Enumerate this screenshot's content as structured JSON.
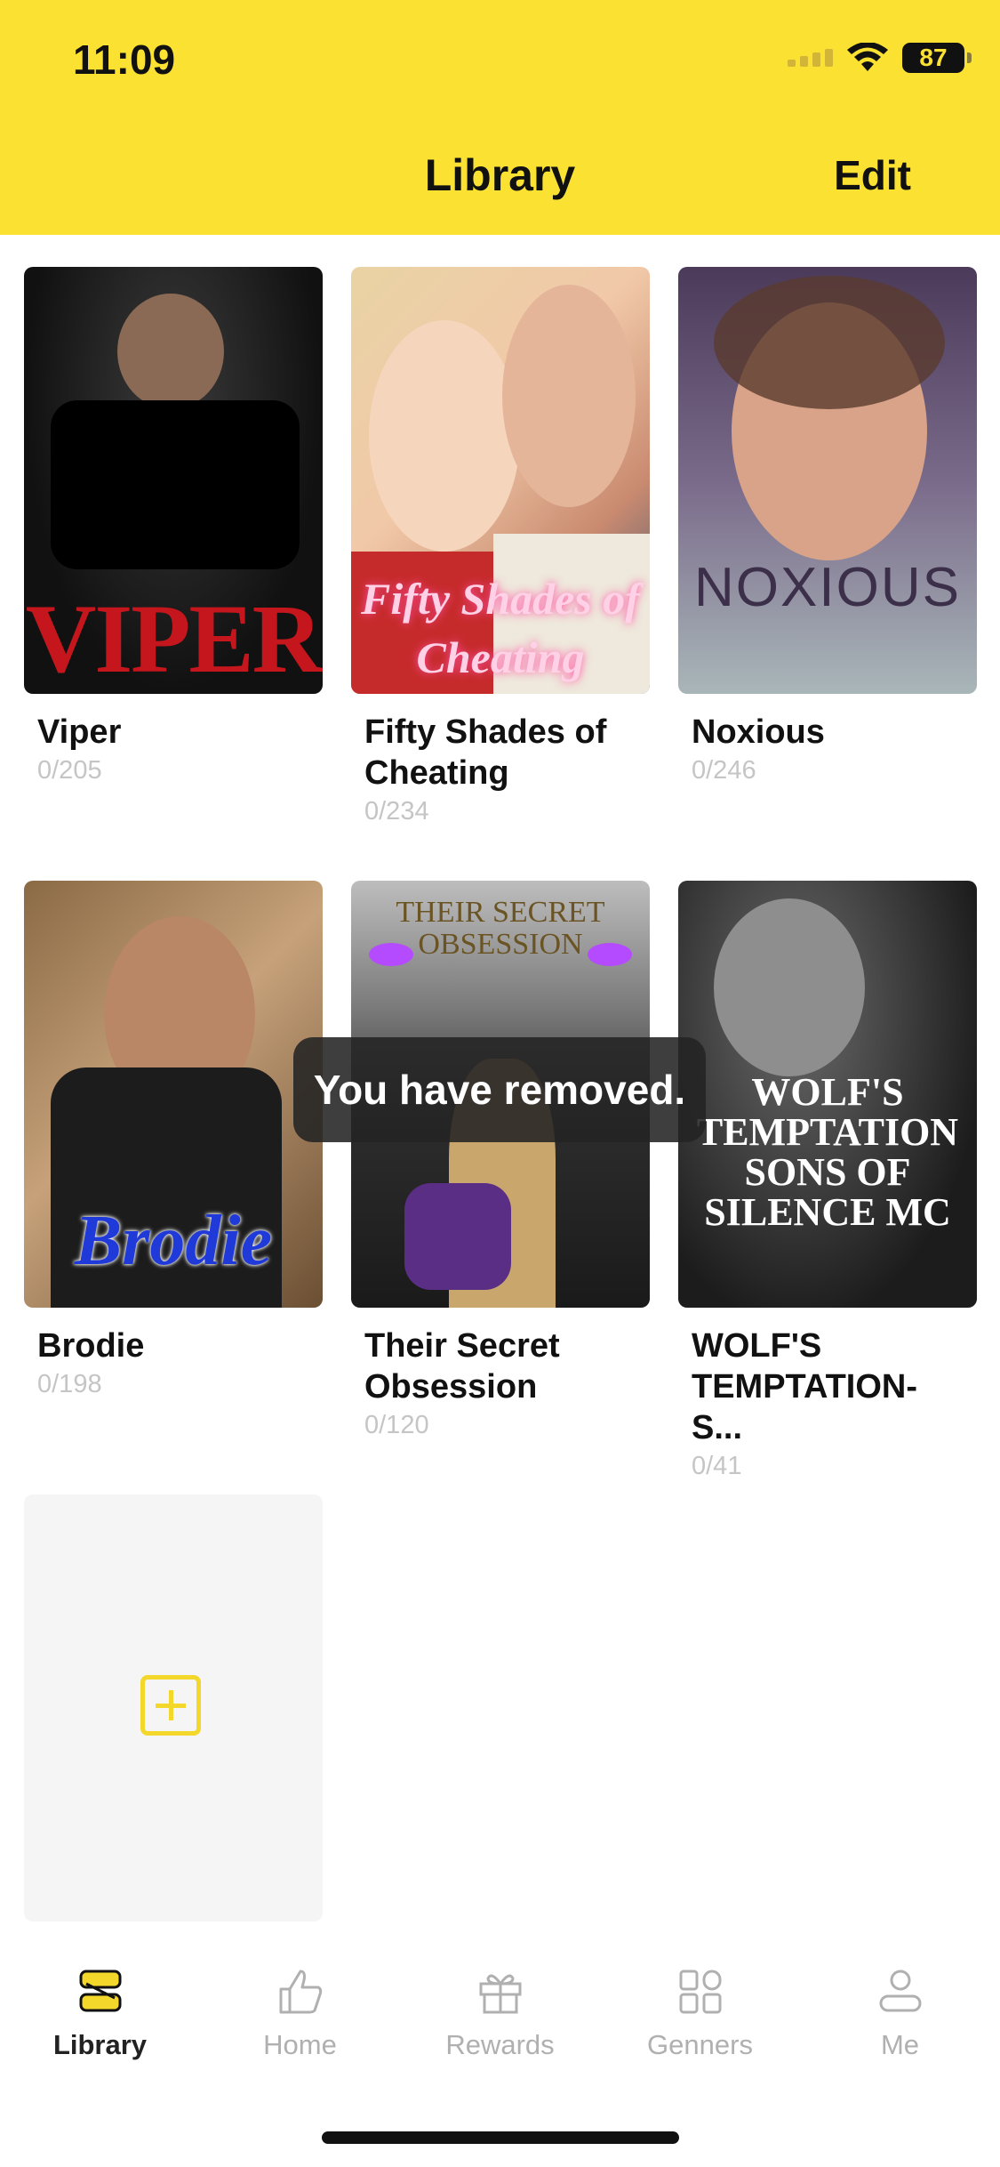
{
  "status_bar": {
    "time": "11:09",
    "battery": "87"
  },
  "header": {
    "title": "Library",
    "edit_label": "Edit"
  },
  "books": [
    {
      "title": "Viper",
      "progress": "0/205",
      "cover_text": "VIPER"
    },
    {
      "title": "Fifty Shades of Cheating",
      "progress": "0/234",
      "cover_text": "Fifty Shades of Cheating"
    },
    {
      "title": "Noxious",
      "progress": "0/246",
      "cover_text": "NOXIOUS"
    },
    {
      "title": "Brodie",
      "progress": "0/198",
      "cover_text": "Brodie"
    },
    {
      "title": "Their Secret Obsession",
      "progress": "0/120",
      "cover_text": "THEIR SECRET OBSESSION"
    },
    {
      "title": "WOLF'S TEMPTATION- S...",
      "progress": "0/41",
      "cover_text": "WOLF'S TEMPTATION SONS OF SILENCE MC"
    }
  ],
  "toast": "You have removed.",
  "tabs": [
    {
      "label": "Library",
      "icon": "library-icon",
      "active": true
    },
    {
      "label": "Home",
      "icon": "thumbs-up-icon"
    },
    {
      "label": "Rewards",
      "icon": "gift-icon"
    },
    {
      "label": "Genners",
      "icon": "grid-icon"
    },
    {
      "label": "Me",
      "icon": "person-icon"
    }
  ],
  "colors": {
    "accent": "#fbe232",
    "toast_bg": "#232323"
  }
}
